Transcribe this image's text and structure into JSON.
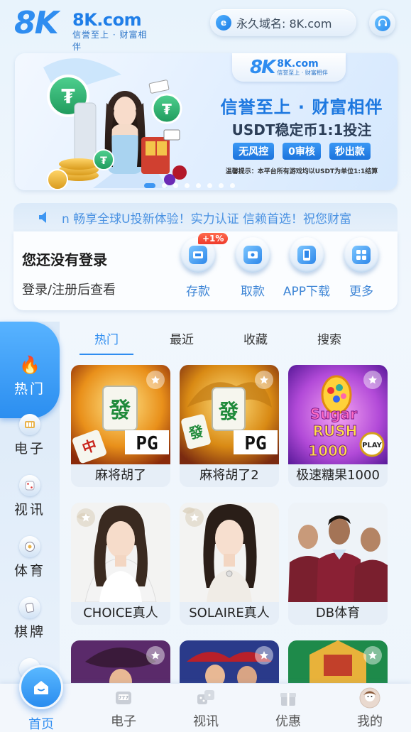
{
  "header": {
    "logo_mark": "8K",
    "logo_domain": "8K.com",
    "logo_slogan": "信誉至上 · 财富相伴",
    "domain_label": "永久域名: 8K.com"
  },
  "banner": {
    "logo_mark": "8K",
    "logo_domain": "8K.com",
    "logo_slogan": "信誉至上 · 财富相伴",
    "headline": "信誉至上 · 财富相伴",
    "subline": "USDT稳定币1:1投注",
    "tags": [
      "无风控",
      "0审核",
      "秒出款"
    ],
    "note": "温馨提示：本平台所有游戏均以USDT为单位1:1结算",
    "slide_count": 8,
    "active_slide": 1
  },
  "marquee": {
    "text": "n 畅享全球U投新体验！实力认证 信赖首选！祝您财富"
  },
  "account": {
    "title": "您还没有登录",
    "subtitle": "登录/注册后查看",
    "actions": [
      {
        "label": "存款",
        "badge": "+1%",
        "icon": "deposit-icon"
      },
      {
        "label": "取款",
        "icon": "withdraw-icon"
      },
      {
        "label": "APP下载",
        "icon": "app-download-icon"
      },
      {
        "label": "更多",
        "icon": "more-icon"
      }
    ]
  },
  "side_nav": [
    {
      "label": "热门",
      "icon": "fire-icon",
      "active": true
    },
    {
      "label": "电子",
      "icon": "slot-icon"
    },
    {
      "label": "视讯",
      "icon": "dice-icon"
    },
    {
      "label": "体育",
      "icon": "ball-icon"
    },
    {
      "label": "棋牌",
      "icon": "cards-icon"
    }
  ],
  "tabs": [
    {
      "label": "热门",
      "active": true
    },
    {
      "label": "最近"
    },
    {
      "label": "收藏"
    },
    {
      "label": "搜索"
    }
  ],
  "games": [
    {
      "name": "麻将胡了",
      "brand": "PG"
    },
    {
      "name": "麻将胡了2",
      "brand": "PG"
    },
    {
      "name": "极速糖果1000",
      "art_text": "Sugar Rush 1000",
      "badge": "PLAY"
    },
    {
      "name": "CHOICE真人"
    },
    {
      "name": "SOLAIRE真人"
    },
    {
      "name": "DB体育"
    }
  ],
  "bottom_nav": [
    {
      "label": "首页",
      "icon": "home-icon",
      "active": true
    },
    {
      "label": "电子",
      "icon": "slot-icon"
    },
    {
      "label": "视讯",
      "icon": "dice-icon"
    },
    {
      "label": "优惠",
      "icon": "gift-icon"
    },
    {
      "label": "我的",
      "icon": "avatar-icon"
    }
  ],
  "colors": {
    "accent": "#2f8df0",
    "badge_red": "#ef3a2c",
    "background": "#eaf3fc"
  }
}
